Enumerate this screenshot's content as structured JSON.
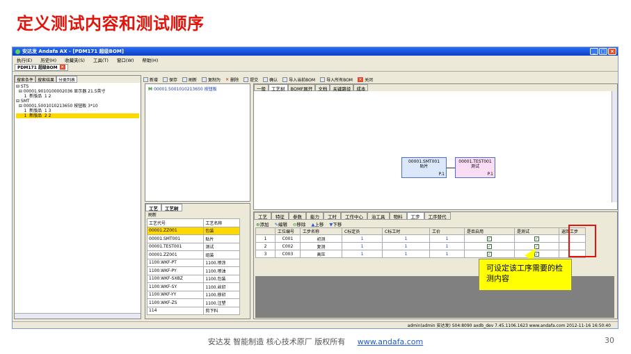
{
  "slide": {
    "title": "定义测试内容和测试顺序",
    "footer_text": "安达发   智能制造 核心技术原厂   版权所有",
    "footer_link": "www.andafa.com",
    "page_number": "30",
    "callout": "可设定该工序需要的检测内容"
  },
  "app": {
    "window_title": "安达发 Andafa AX - [PDM171 超级BOM]",
    "menu": [
      "执行(E)",
      "历史(H)",
      "收藏夹(S)",
      "工具(T)",
      "窗口(W)",
      "帮助(H)"
    ],
    "doc_tab": "PDM171 超级BOM"
  },
  "left": {
    "tabs": [
      "搜索条件",
      "搜索结果",
      "分类列表"
    ],
    "tree": [
      "⊟ STS",
      "  ⊟ 00001.9010100002036 显示器 21.5英寸",
      "      1  新版品  1 2",
      "⊟ SMT",
      "  ⊟ 00001.5001010213650 按钮板 3*10",
      "      1  新版品  1 3",
      "      1  新版品  2 2"
    ]
  },
  "toolbar": [
    "新增",
    "保存",
    "刷新",
    "复制为",
    "删除",
    "提交",
    "确认",
    "导入当前BOM",
    "导入所有BOM",
    "关闭"
  ],
  "center": {
    "bom_item": "00001.5001010213650 按钮板",
    "tabs": [
      "工艺",
      "工艺树"
    ],
    "refresh": "刷新",
    "proc_headers": [
      "工艺代号",
      "工艺名称"
    ],
    "procs": [
      [
        "00001.ZZ001",
        "包装"
      ],
      [
        "00001.SMT001",
        "贴片"
      ],
      [
        "00001.TEST001",
        "测试"
      ],
      [
        "00001.ZZ001",
        "组装"
      ],
      [
        "1100.WKF-PT",
        "1100.喷涂"
      ],
      [
        "1100.WKF-PY",
        "1100.喷油"
      ],
      [
        "1100.WKF-SXBZ",
        "1100.包装"
      ],
      [
        "1100.WKF-SY",
        "1100.丝印"
      ],
      [
        "1100.WKF-YY",
        "1100.移印"
      ],
      [
        "1100.WKF-ZS",
        "1100.注塑"
      ],
      [
        "114",
        "剪下料"
      ]
    ]
  },
  "right": {
    "tabs": [
      "一般",
      "工艺树",
      "BOMF展开",
      "文档",
      "关键路径",
      "成本"
    ],
    "node1": {
      "id": "00001.SMT001",
      "name": "贴片",
      "foot": "P.1"
    },
    "node2": {
      "id": "00001.TEST001",
      "name": "测试",
      "foot": "P.1"
    },
    "bottom_tabs": [
      "工艺",
      "特征",
      "参数",
      "能力",
      "工时",
      "工作中心",
      "治工具",
      "物料",
      "工步",
      "工序替代"
    ],
    "actions": [
      "添加",
      "编辑",
      "移除",
      "上移",
      "下移"
    ],
    "step_headers": [
      "",
      "工位编号",
      "工步名称",
      "C标定员",
      "C标工时",
      "工价",
      "是否启用",
      "是测试",
      "返回工步"
    ],
    "steps": [
      [
        "1",
        "C001",
        "初测",
        "1",
        "1",
        "1"
      ],
      [
        "2",
        "C002",
        "复测",
        "1",
        "1",
        "1"
      ],
      [
        "3",
        "C003",
        "高压",
        "1",
        "1",
        "1"
      ]
    ]
  },
  "status": "admin(admin 安达发)  S04:8090  axdb_dev  7.45.1106.1623  www.andafa.com  2012-11-16 16:50:40"
}
